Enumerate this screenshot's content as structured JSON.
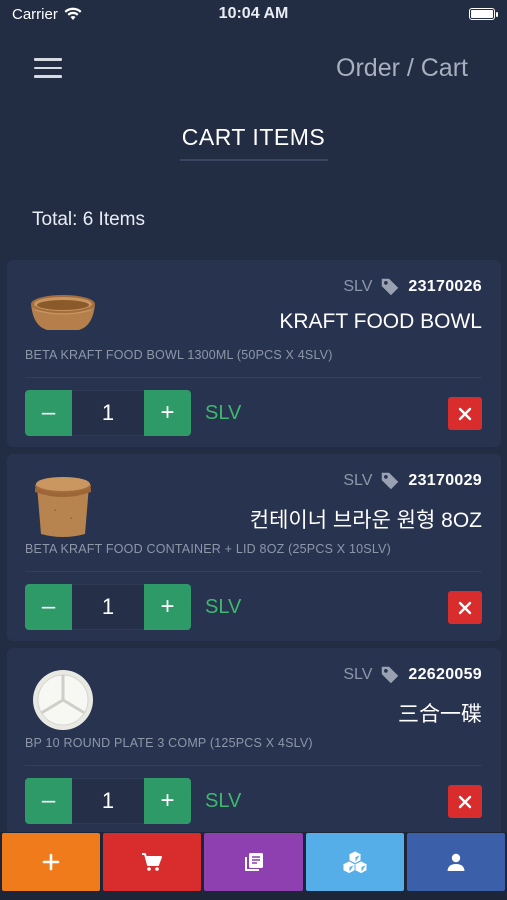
{
  "status": {
    "carrier": "Carrier",
    "time": "10:04 AM"
  },
  "header": {
    "title": "Order / Cart"
  },
  "section": {
    "title": "CART ITEMS"
  },
  "summary": {
    "total": "Total: 6 Items"
  },
  "items": [
    {
      "unit_label": "SLV",
      "code": "23170026",
      "name": "KRAFT FOOD BOWL",
      "description": "BETA KRAFT FOOD BOWL 1300ML (50PCS X 4SLV)",
      "quantity": "1",
      "unit": "SLV",
      "minus": "–",
      "plus": "+",
      "image": "kraft-bowl"
    },
    {
      "unit_label": "SLV",
      "code": "23170029",
      "name": "컨테이너 브라운 원형 8OZ",
      "description": "BETA KRAFT FOOD CONTAINER + LID 8OZ (25PCS X 10SLV)",
      "quantity": "1",
      "unit": "SLV",
      "minus": "–",
      "plus": "+",
      "image": "kraft-container"
    },
    {
      "unit_label": "SLV",
      "code": "22620059",
      "name": "三合一碟",
      "description": "BP 10 ROUND PLATE 3 COMP (125PCS X 4SLV)",
      "quantity": "1",
      "unit": "SLV",
      "minus": "–",
      "plus": "+",
      "image": "round-plate"
    }
  ],
  "tabs": [
    {
      "icon": "plus-icon",
      "color": "#f07b1a"
    },
    {
      "icon": "cart-icon",
      "color": "#d92d2d"
    },
    {
      "icon": "catalog-icon",
      "color": "#8e3fb0"
    },
    {
      "icon": "boxes-icon",
      "color": "#55aee8"
    },
    {
      "icon": "user-icon",
      "color": "#3b5fa8"
    }
  ],
  "colors": {
    "background": "#222c43",
    "card": "#283350",
    "accent_green": "#2e9a68",
    "unit_green": "#3fb86f",
    "delete_red": "#d92d2d"
  }
}
